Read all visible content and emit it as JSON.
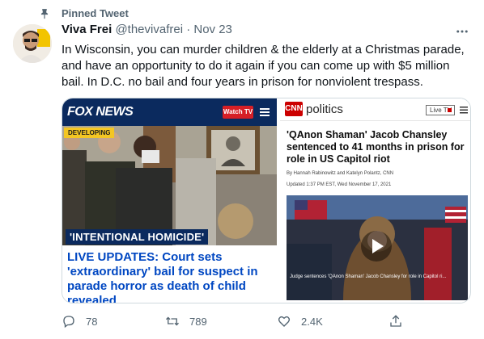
{
  "pinned": {
    "label": "Pinned Tweet"
  },
  "tweet": {
    "author_name": "Viva Frei",
    "handle": "@thevivafrei",
    "separator": "·",
    "date": "Nov 23",
    "text": "In Wisconsin, you can murder children & the elderly at a Christmas parade, and have an opportunity to do it again if you can come up with $5 million bail. In D.C. no bail and four years in prison for nonviolent trespass."
  },
  "media": {
    "fox": {
      "logo": "FOX NEWS",
      "watch_tv": "Watch TV",
      "developing": "DEVELOPING",
      "banner": "'INTENTIONAL HOMICIDE'",
      "headline": "LIVE UPDATES: Court sets 'extraordinary' bail for suspect in parade horror as death of child revealed"
    },
    "cnn": {
      "logo": "CNN",
      "section": "politics",
      "live_tv": "Live TV",
      "headline": "'QAnon Shaman' Jacob Chansley sentenced to 41 months in prison for role in US Capitol riot",
      "byline": "By Hannah Rabinowitz and Katelyn Polantz, CNN",
      "updated": "Updated 1:37 PM EST, Wed November 17, 2021",
      "video_caption": "Judge sentences 'QAnon Shaman' Jacob Chansley for role in Capitol ri..."
    }
  },
  "actions": {
    "reply_count": "78",
    "retweet_count": "789",
    "like_count": "2.4K"
  },
  "colors": {
    "accent_gray": "#536471",
    "fox_blue": "#0b2a5e",
    "fox_headline": "#0047c2",
    "cnn_red": "#cc0000"
  },
  "icons": {
    "pin": "pin-icon",
    "more": "more-icon",
    "reply": "reply-icon",
    "retweet": "retweet-icon",
    "like": "heart-icon",
    "share": "share-icon"
  }
}
